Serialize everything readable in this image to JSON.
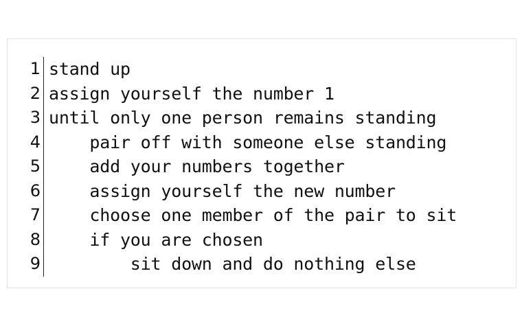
{
  "code": {
    "lines": [
      {
        "number": "1",
        "text": "stand up"
      },
      {
        "number": "2",
        "text": "assign yourself the number 1"
      },
      {
        "number": "3",
        "text": "until only one person remains standing"
      },
      {
        "number": "4",
        "text": "    pair off with someone else standing"
      },
      {
        "number": "5",
        "text": "    add your numbers together"
      },
      {
        "number": "6",
        "text": "    assign yourself the new number"
      },
      {
        "number": "7",
        "text": "    choose one member of the pair to sit"
      },
      {
        "number": "8",
        "text": "    if you are chosen"
      },
      {
        "number": "9",
        "text": "        sit down and do nothing else"
      }
    ]
  }
}
